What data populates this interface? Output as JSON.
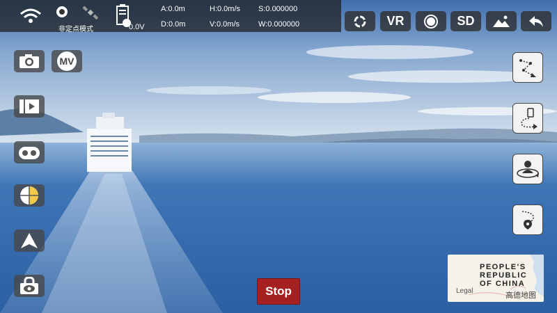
{
  "status_bar": {
    "mode_label": "非定点模式",
    "voltage": "0.0V",
    "altitude": "A:0.0m",
    "distance": "D:0.0m",
    "h_speed": "H:0.0m/s",
    "v_speed": "V:0.0m/s",
    "s_value": "S:0.000000",
    "w_value": "W:0.000000",
    "icons": [
      "wifi-icon",
      "camera-signal-icon",
      "satellite-icon",
      "battery-icon"
    ]
  },
  "top_buttons": {
    "rotate_icon": "rotate-icon",
    "vr_label": "VR",
    "exposure_icon": "exposure-icon",
    "sd_label": "SD",
    "gallery_icon": "gallery-icon",
    "back_icon": "back-arrow-icon"
  },
  "left_tools": {
    "mv_label": "MV",
    "icons": [
      "camera-icon",
      "mv-icon",
      "video-icon",
      "controller-icon",
      "gyro-calibrate-icon",
      "navigation-arrow-icon",
      "eye-lock-icon"
    ]
  },
  "right_tools": {
    "icons": [
      "waypoint-route-icon",
      "follow-path-icon",
      "orbit-person-icon",
      "return-location-icon"
    ]
  },
  "stop_label": "Stop",
  "map": {
    "region_label_lines": [
      "PEOPLE'S",
      "REPUBLIC",
      "OF CHINA"
    ],
    "legal_label": "Legal",
    "brand_label": "高德地图"
  }
}
